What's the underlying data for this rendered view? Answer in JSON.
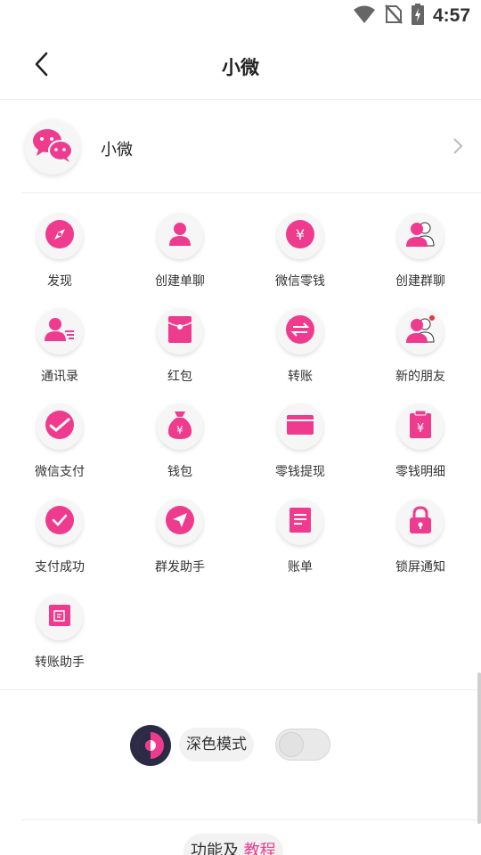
{
  "status_bar": {
    "time": "4:57",
    "icons": [
      "wifi-icon",
      "no-sim-icon",
      "battery-charging-icon"
    ]
  },
  "header": {
    "title": "小微",
    "back_icon": "back-arrow-icon"
  },
  "profile": {
    "name": "小微",
    "avatar_icon": "wechat-logo-icon",
    "chevron_icon": "chevron-right-icon"
  },
  "grid": {
    "items": [
      {
        "label": "发现",
        "icon": "compass-icon"
      },
      {
        "label": "创建单聊",
        "icon": "single-user-icon"
      },
      {
        "label": "微信零钱",
        "icon": "yen-coin-icon"
      },
      {
        "label": "创建群聊",
        "icon": "group-users-icon"
      },
      {
        "label": "通讯录",
        "icon": "contact-list-icon"
      },
      {
        "label": "红包",
        "icon": "red-envelope-icon"
      },
      {
        "label": "转账",
        "icon": "transfer-icon"
      },
      {
        "label": "新的朋友",
        "icon": "new-friend-icon"
      },
      {
        "label": "微信支付",
        "icon": "wechat-pay-icon"
      },
      {
        "label": "钱包",
        "icon": "money-bag-icon"
      },
      {
        "label": "零钱提现",
        "icon": "card-icon"
      },
      {
        "label": "零钱明细",
        "icon": "receipt-icon"
      },
      {
        "label": "支付成功",
        "icon": "check-circle-icon"
      },
      {
        "label": "群发助手",
        "icon": "send-plane-icon"
      },
      {
        "label": "账单",
        "icon": "bill-icon"
      },
      {
        "label": "锁屏通知",
        "icon": "lock-icon"
      },
      {
        "label": "转账助手",
        "icon": "transfer-assistant-icon"
      }
    ]
  },
  "dark_mode": {
    "label": "深色模式",
    "enabled": false
  },
  "footer": {
    "tutorial_prefix": "功能及",
    "tutorial_link": "教程"
  },
  "colors": {
    "accent": "#ee3b8e",
    "dark_icon_bg": "#2b2b45",
    "icon_circle_bg": "#f6f6f6"
  }
}
